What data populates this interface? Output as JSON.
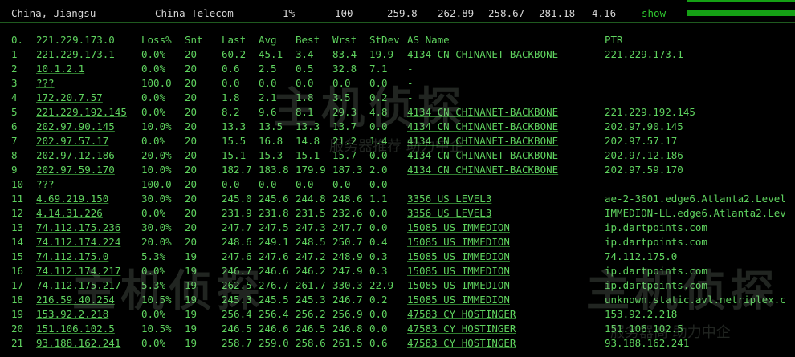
{
  "topbar": {
    "location": "China, Jiangsu",
    "isp": "China Telecom",
    "loss": "1%",
    "snt": "100",
    "last": "259.8",
    "avg": "262.89",
    "best": "258.67",
    "wrst": "281.18",
    "stdev": "4.16",
    "show_label": "show"
  },
  "header": {
    "idx": "0.",
    "host": "221.229.173.0",
    "loss": "Loss%",
    "snt": "Snt",
    "last": "Last",
    "avg": "Avg",
    "best": "Best",
    "wrst": "Wrst",
    "stdev": "StDev",
    "as": "AS Name",
    "ptr": "PTR"
  },
  "rows": [
    {
      "idx": "1",
      "host": "221.229.173.1",
      "loss": "0.0%",
      "snt": "20",
      "last": "60.2",
      "avg": "45.1",
      "best": "3.4",
      "wrst": "83.4",
      "stdev": "19.9",
      "as": "4134  CN CHINANET-BACKBONE",
      "ptr": "221.229.173.1"
    },
    {
      "idx": "2",
      "host": "10.1.2.1",
      "loss": "0.0%",
      "snt": "20",
      "last": "0.6",
      "avg": "2.5",
      "best": "0.5",
      "wrst": "32.8",
      "stdev": "7.1",
      "as": "-",
      "ptr": ""
    },
    {
      "idx": "3",
      "host": "???",
      "loss": "100.0",
      "snt": "20",
      "last": "0.0",
      "avg": "0.0",
      "best": "0.0",
      "wrst": "0.0",
      "stdev": "0.0",
      "as": "-",
      "ptr": ""
    },
    {
      "idx": "4",
      "host": "172.20.7.57",
      "loss": "0.0%",
      "snt": "20",
      "last": "1.8",
      "avg": "2.1",
      "best": "1.8",
      "wrst": "3.5",
      "stdev": "0.2",
      "as": "-",
      "ptr": ""
    },
    {
      "idx": "5",
      "host": "221.229.192.145",
      "loss": "0.0%",
      "snt": "20",
      "last": "8.2",
      "avg": "9.6",
      "best": "8.1",
      "wrst": "29.3",
      "stdev": "4.8",
      "as": "4134  CN CHINANET-BACKBONE",
      "ptr": "221.229.192.145"
    },
    {
      "idx": "6",
      "host": "202.97.90.145",
      "loss": "10.0%",
      "snt": "20",
      "last": "13.3",
      "avg": "13.5",
      "best": "13.3",
      "wrst": "13.7",
      "stdev": "0.0",
      "as": "4134  CN CHINANET-BACKBONE",
      "ptr": "202.97.90.145"
    },
    {
      "idx": "7",
      "host": "202.97.57.17",
      "loss": "0.0%",
      "snt": "20",
      "last": "15.5",
      "avg": "16.8",
      "best": "14.8",
      "wrst": "21.2",
      "stdev": "1.4",
      "as": "4134  CN CHINANET-BACKBONE",
      "ptr": "202.97.57.17"
    },
    {
      "idx": "8",
      "host": "202.97.12.186",
      "loss": "20.0%",
      "snt": "20",
      "last": "15.1",
      "avg": "15.3",
      "best": "15.1",
      "wrst": "15.7",
      "stdev": "0.0",
      "as": "4134  CN CHINANET-BACKBONE",
      "ptr": "202.97.12.186"
    },
    {
      "idx": "9",
      "host": "202.97.59.170",
      "loss": "10.0%",
      "snt": "20",
      "last": "182.7",
      "avg": "183.8",
      "best": "179.9",
      "wrst": "187.3",
      "stdev": "2.0",
      "as": "4134  CN CHINANET-BACKBONE",
      "ptr": "202.97.59.170"
    },
    {
      "idx": "10",
      "host": "???",
      "loss": "100.0",
      "snt": "20",
      "last": "0.0",
      "avg": "0.0",
      "best": "0.0",
      "wrst": "0.0",
      "stdev": "0.0",
      "as": "-",
      "ptr": ""
    },
    {
      "idx": "11",
      "host": "4.69.219.150",
      "loss": "30.0%",
      "snt": "20",
      "last": "245.0",
      "avg": "245.6",
      "best": "244.8",
      "wrst": "248.6",
      "stdev": "1.1",
      "as": "3356  US LEVEL3",
      "ptr": "ae-2-3601.edge6.Atlanta2.Level"
    },
    {
      "idx": "12",
      "host": "4.14.31.226",
      "loss": "0.0%",
      "snt": "20",
      "last": "231.9",
      "avg": "231.8",
      "best": "231.5",
      "wrst": "232.6",
      "stdev": "0.0",
      "as": "3356  US LEVEL3",
      "ptr": "IMMEDION-LL.edge6.Atlanta2.Lev"
    },
    {
      "idx": "13",
      "host": "74.112.175.236",
      "loss": "30.0%",
      "snt": "20",
      "last": "247.7",
      "avg": "247.5",
      "best": "247.3",
      "wrst": "247.7",
      "stdev": "0.0",
      "as": "15085 US IMMEDION",
      "ptr": "ip.dartpoints.com"
    },
    {
      "idx": "14",
      "host": "74.112.174.224",
      "loss": "20.0%",
      "snt": "20",
      "last": "248.6",
      "avg": "249.1",
      "best": "248.5",
      "wrst": "250.7",
      "stdev": "0.4",
      "as": "15085 US IMMEDION",
      "ptr": "ip.dartpoints.com"
    },
    {
      "idx": "15",
      "host": "74.112.175.0",
      "loss": "5.3%",
      "snt": "19",
      "last": "247.6",
      "avg": "247.6",
      "best": "247.2",
      "wrst": "248.9",
      "stdev": "0.3",
      "as": "15085 US IMMEDION",
      "ptr": "74.112.175.0"
    },
    {
      "idx": "16",
      "host": "74.112.174.217",
      "loss": "0.0%",
      "snt": "19",
      "last": "246.7",
      "avg": "246.6",
      "best": "246.2",
      "wrst": "247.9",
      "stdev": "0.3",
      "as": "15085 US IMMEDION",
      "ptr": "ip.dartpoints.com"
    },
    {
      "idx": "17",
      "host": "74.112.175.217",
      "loss": "5.3%",
      "snt": "19",
      "last": "262.5",
      "avg": "276.7",
      "best": "261.7",
      "wrst": "330.3",
      "stdev": "22.9",
      "as": "15085 US IMMEDION",
      "ptr": "ip.dartpoints.com"
    },
    {
      "idx": "18",
      "host": "216.59.40.254",
      "loss": "10.5%",
      "snt": "19",
      "last": "245.3",
      "avg": "245.5",
      "best": "245.3",
      "wrst": "246.7",
      "stdev": "0.2",
      "as": "15085 US IMMEDION",
      "ptr": "unknown.static.avl.netriplex.c"
    },
    {
      "idx": "19",
      "host": "153.92.2.218",
      "loss": "0.0%",
      "snt": "19",
      "last": "256.4",
      "avg": "256.4",
      "best": "256.2",
      "wrst": "256.9",
      "stdev": "0.0",
      "as": "47583 CY HOSTINGER",
      "ptr": "153.92.2.218"
    },
    {
      "idx": "20",
      "host": "151.106.102.5",
      "loss": "10.5%",
      "snt": "19",
      "last": "246.5",
      "avg": "246.6",
      "best": "246.5",
      "wrst": "246.8",
      "stdev": "0.0",
      "as": "47583 CY HOSTINGER",
      "ptr": "151.106.102.5"
    },
    {
      "idx": "21",
      "host": "93.188.162.241",
      "loss": "0.0%",
      "snt": "19",
      "last": "258.7",
      "avg": "259.0",
      "best": "258.6",
      "wrst": "261.5",
      "stdev": "0.6",
      "as": "47583 CY HOSTINGER",
      "ptr": "93.188.162.241"
    }
  ],
  "watermark": {
    "text1": "主机侦探",
    "text2": "服务器推荐 助力中企",
    "text3": "主机侦探",
    "text4": "服务器商 助力中企"
  },
  "colors": {
    "background": "#000000",
    "text": "#5fd35f",
    "header_text": "#d6d6d6",
    "bar": "#15a015"
  }
}
